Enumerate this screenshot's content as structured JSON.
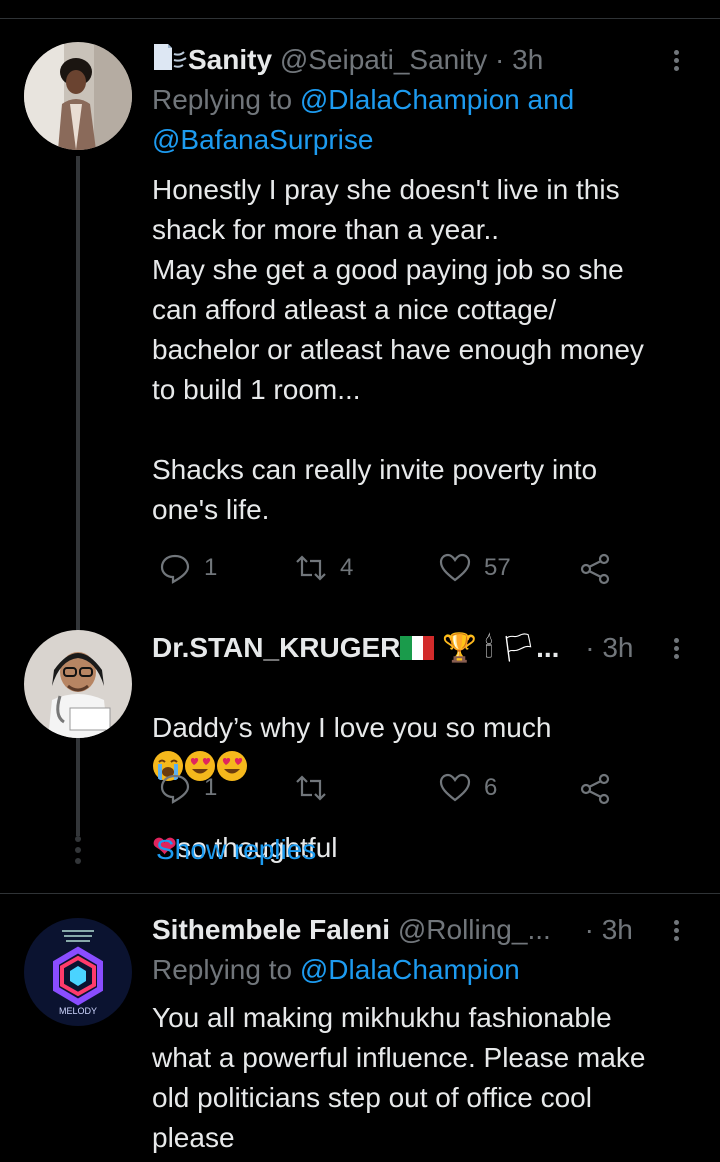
{
  "tweets": [
    {
      "name": "Sanity",
      "handle": "@Seipati_Sanity",
      "dot": "·",
      "time": "3h",
      "replying_prefix": "Replying to ",
      "replying_to_1": "@DlalaChampion",
      "replying_and": " and",
      "replying_to_2": "@BafanaSurprise",
      "text": "Honestly I pray she doesn't live in this\nshack for more than a year..\nMay she get a good paying job so she\ncan afford atleast a nice cottage/\nbachelor or atleast have enough money\nto build 1 room...\n\nShacks can really invite poverty into\none's life.",
      "replies": "1",
      "retweets": "4",
      "likes": "57"
    },
    {
      "name": "Dr.STAN_KRUGER",
      "name_suffix": "...",
      "dot": "·",
      "time": "3h",
      "text_line1": "Daddy’s why I love you so much",
      "text_line2": "so thoughtful",
      "replies": "1",
      "retweets": "",
      "likes": "6"
    },
    {
      "name": "Sithembele Faleni",
      "handle": "@Rolling_...",
      "dot": "·",
      "time": "3h",
      "replying_prefix": "Replying to ",
      "replying_to_1": "@DlalaChampion",
      "text": "You all making mikhukhu fashionable\nwhat a powerful influence. Please make\nold politicians step out of office cool\nplease",
      "avatar_label": "MELODY"
    }
  ],
  "show_replies": "Show replies",
  "colors": {
    "link": "#1d9bf0",
    "muted": "#71767b",
    "text": "#e7e9ea",
    "background": "#000000"
  }
}
